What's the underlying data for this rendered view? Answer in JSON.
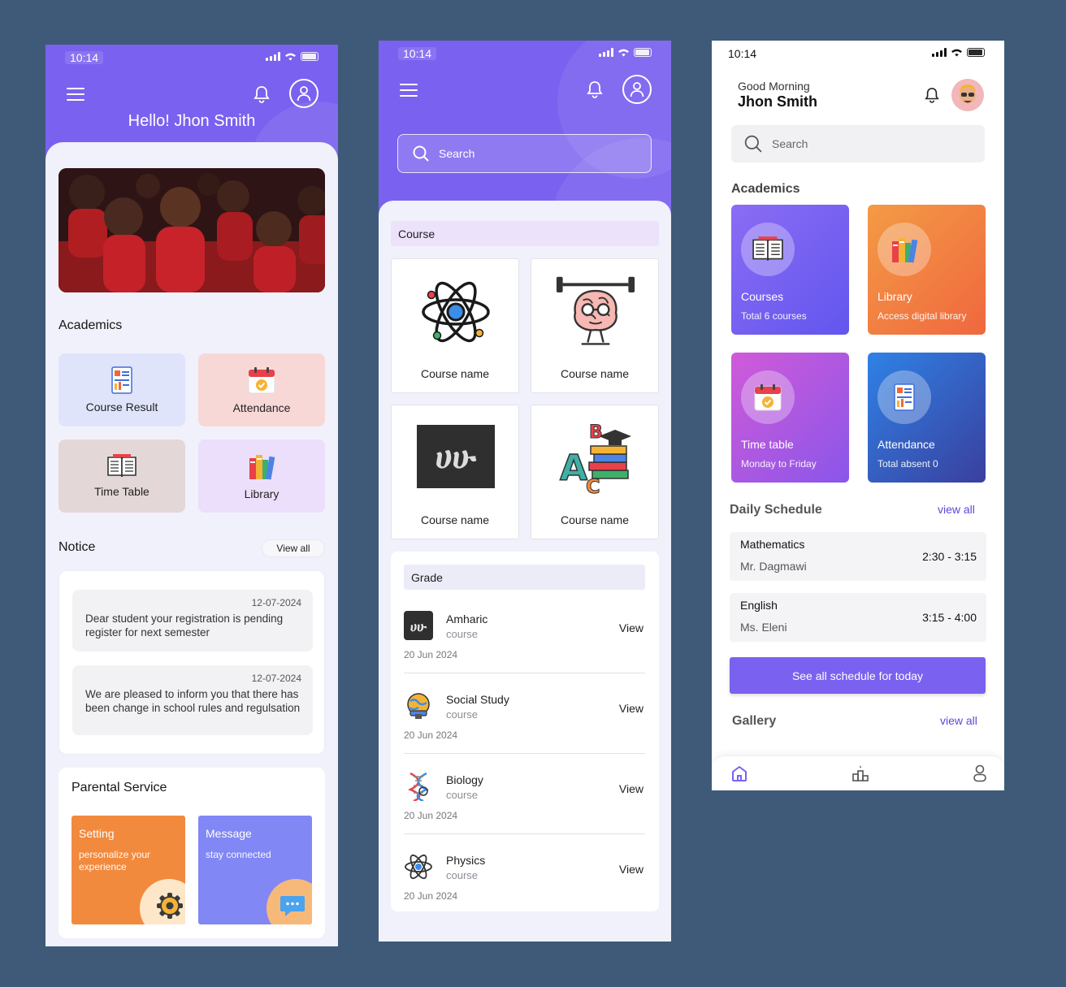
{
  "colors": {
    "background": "#3f5a78",
    "primary": "#7b61ef",
    "accent_orange": "#f28a3e",
    "accent_blue_purple": "#8187f4"
  },
  "phone1": {
    "status_time": "10:14",
    "greeting": "Hello!  Jhon Smith",
    "academics_title": "Academics",
    "tiles": [
      {
        "label": "Course Result",
        "icon": "report-icon",
        "color": "#dfe4fb"
      },
      {
        "label": "Attendance",
        "icon": "calendar-check-icon",
        "color": "#f8d8d7"
      },
      {
        "label": "Time Table",
        "icon": "book-icon",
        "color": "#e3d7d7"
      },
      {
        "label": "Library",
        "icon": "books-icon",
        "color": "#ecdffb"
      }
    ],
    "notice_title": "Notice",
    "notice_view_all": "View all",
    "notices": [
      {
        "date": "12-07-2024",
        "text": "Dear student your registration is pending register for next semester"
      },
      {
        "date": "12-07-2024",
        "text": "We are pleased to inform you that there has been change in school rules and regulsation"
      }
    ],
    "parental_title": "Parental Service",
    "parental_cards": [
      {
        "title": "Setting",
        "desc": "personalize your experience",
        "icon": "gear-icon"
      },
      {
        "title": "Message",
        "desc": "stay connected",
        "icon": "chat-icon"
      }
    ]
  },
  "phone2": {
    "status_time": "10:14",
    "search_placeholder": "Search",
    "course_band": "Course",
    "courses": [
      {
        "name": "Course name",
        "icon": "atom-icon"
      },
      {
        "name": "Course name",
        "icon": "brain-lifting-icon"
      },
      {
        "name": "Course name",
        "icon": "amharic-letters-icon"
      },
      {
        "name": "Course name",
        "icon": "abc-books-icon"
      }
    ],
    "grade_band": "Grade",
    "grades": [
      {
        "name": "Amharic",
        "sub": "course",
        "date": "20 Jun 2024",
        "action": "View",
        "icon": "amharic-letters-icon"
      },
      {
        "name": "Social Study",
        "sub": "course",
        "date": "20 Jun 2024",
        "action": "View",
        "icon": "globe-icon"
      },
      {
        "name": "Biology",
        "sub": "course",
        "date": "20 Jun 2024",
        "action": "View",
        "icon": "dna-icon"
      },
      {
        "name": "Physics",
        "sub": "course",
        "date": "20 Jun 2024",
        "action": "View",
        "icon": "atom-icon"
      }
    ]
  },
  "phone3": {
    "status_time": "10:14",
    "greeting": "Good Morning",
    "name": "Jhon Smith",
    "search_placeholder": "Search",
    "academics_title": "Academics",
    "cards": [
      {
        "title": "Courses",
        "desc": "Total 6 courses",
        "icon": "book-icon"
      },
      {
        "title": "Library",
        "desc": "Access digital library",
        "icon": "books-icon"
      },
      {
        "title": "Time table",
        "desc": "Monday to Friday",
        "icon": "calendar-check-icon"
      },
      {
        "title": "Attendance",
        "desc": "Total absent 0",
        "icon": "report-icon"
      }
    ],
    "schedule_title": "Daily Schedule",
    "schedule_view_all": "view all",
    "schedule": [
      {
        "subject": "Mathematics",
        "teacher": "Mr. Dagmawi",
        "time": "2:30 - 3:15"
      },
      {
        "subject": "English",
        "teacher": "Ms. Eleni",
        "time": "3:15 - 4:00"
      }
    ],
    "see_all_button": "See all schedule for today",
    "gallery_title": "Gallery",
    "gallery_view_all": "view all",
    "tabs": [
      "home-icon",
      "leaderboard-icon",
      "profile-icon"
    ]
  }
}
